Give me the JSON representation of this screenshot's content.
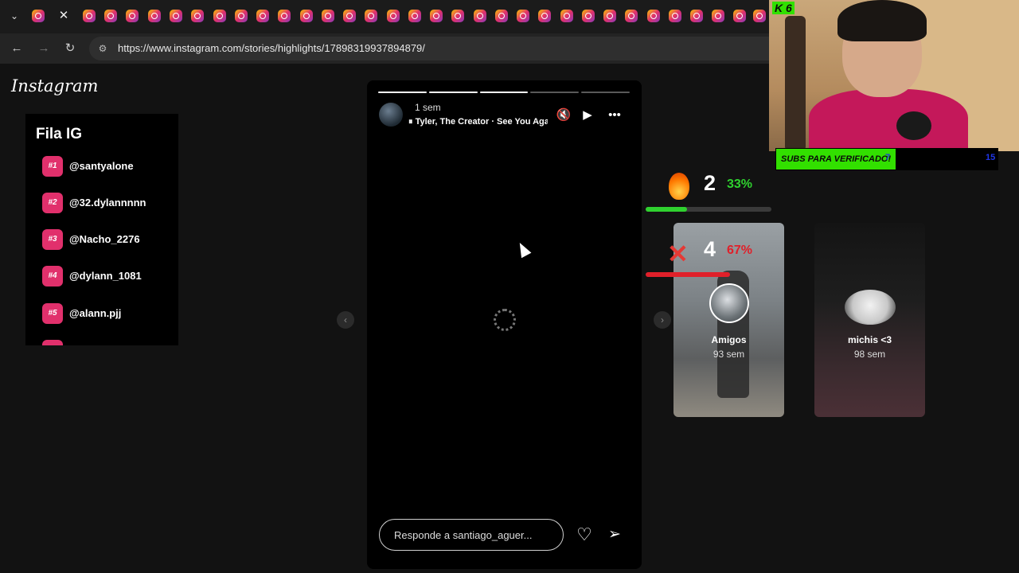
{
  "browser": {
    "url": "https://www.instagram.com/stories/highlights/17898319937894879/",
    "tab_count": 33
  },
  "instagram": {
    "logo_text": "Instagram"
  },
  "queue": {
    "title": "Fila IG",
    "items": [
      {
        "badge": "#1",
        "name": "@santyalone"
      },
      {
        "badge": "#2",
        "name": "@32.dylannnnn"
      },
      {
        "badge": "#3",
        "name": "@Nacho_2276"
      },
      {
        "badge": "#4",
        "name": "@dylann_1081"
      },
      {
        "badge": "#5",
        "name": "@alann.pjj"
      }
    ]
  },
  "story": {
    "time": "1 sem",
    "music": "Tyler, The Creator · See You Aga",
    "reply_placeholder": "Responde a santiago_aguer...",
    "segments_total": 5,
    "segments_viewed": 3
  },
  "highlights": [
    {
      "title": "Amigos",
      "age": "93 sem"
    },
    {
      "title": "michis <3",
      "age": "98 sem"
    }
  ],
  "votes": {
    "fire": {
      "count": "2",
      "percent": "33%",
      "fill": 0.33,
      "color": "#2fd12f"
    },
    "cross": {
      "count": "4",
      "percent": "67%",
      "fill": 0.67,
      "color": "#e0202a"
    }
  },
  "overlay": {
    "cam_logo": "K 6",
    "subs_label": "SUBS PARA VERIFICADO!",
    "subs_current": "7",
    "subs_goal": "15"
  },
  "colors": {
    "accent_pink": "#e1306c",
    "subs_green": "#32e000"
  }
}
